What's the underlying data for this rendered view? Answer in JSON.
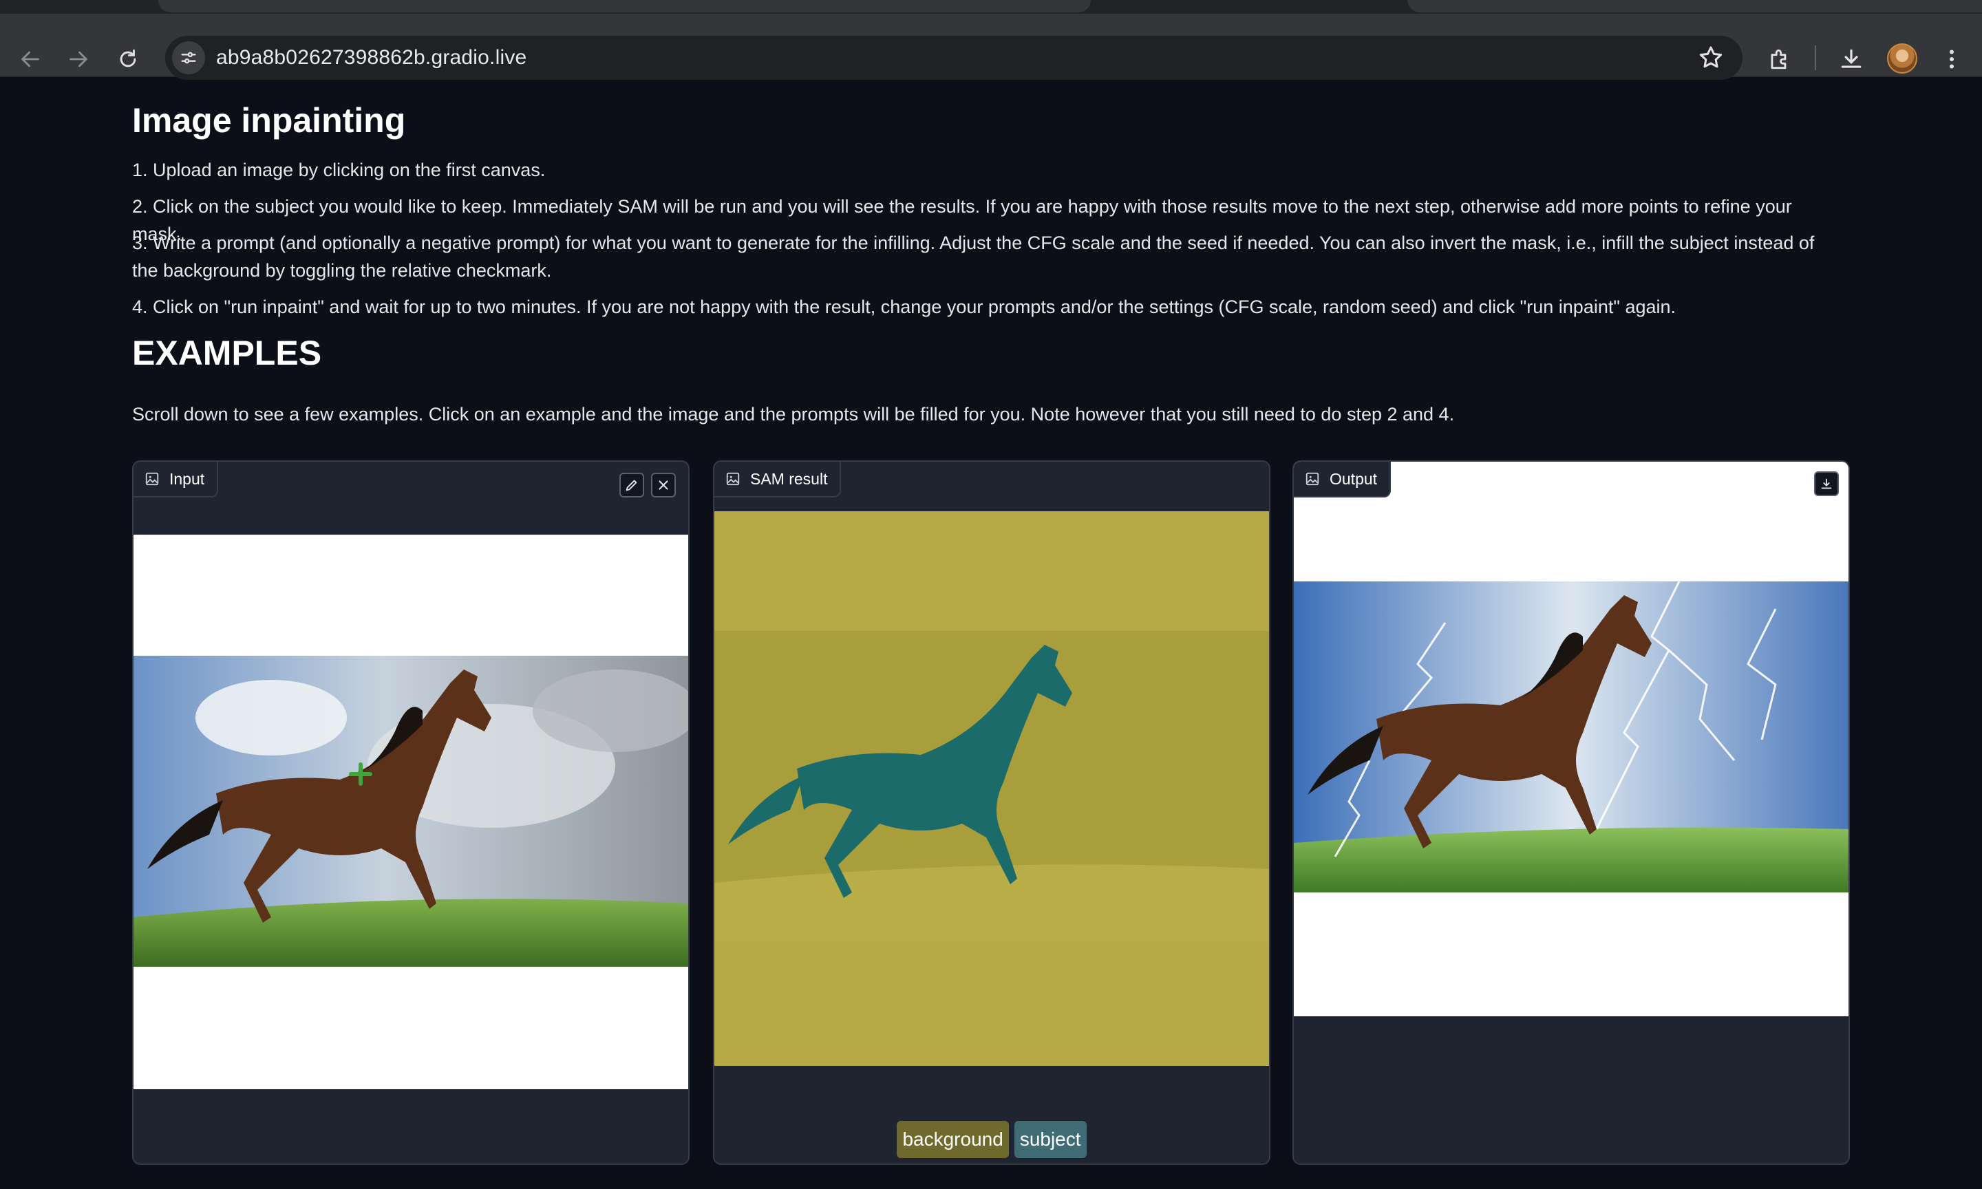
{
  "browser": {
    "url": "ab9a8b02627398862b.gradio.live"
  },
  "page": {
    "title": "Image inpainting",
    "steps": [
      "1. Upload an image by clicking on the first canvas.",
      "2. Click on the subject you would like to keep. Immediately SAM will be run and you will see the results. If you are happy with those results move to the next step, otherwise add more points to refine your mask.",
      "3. Write a prompt (and optionally a negative prompt) for what you want to generate for the infilling. Adjust the CFG scale and the seed if needed. You can also invert the mask, i.e., infill the subject instead of the background by toggling the relative checkmark.",
      "4. Click on \"run inpaint\" and wait for up to two minutes. If you are not happy with the result, change your prompts and/or the settings (CFG scale, random seed) and click \"run inpaint\" again."
    ],
    "examples_title": "EXAMPLES",
    "examples_text": "Scroll down to see a few examples. Click on an example and the image and the prompts will be filled for you. Note however that you still need to do step 2 and 4."
  },
  "panels": {
    "input": {
      "label": "Input",
      "label_icon": "image-icon",
      "edit_icon": "pencil-icon",
      "clear_icon": "close-icon"
    },
    "sam": {
      "label": "SAM result",
      "label_icon": "image-icon"
    },
    "output": {
      "label": "Output",
      "label_icon": "image-icon",
      "download_icon": "download-icon"
    }
  },
  "legend": [
    {
      "label": "background",
      "color": "#6f6a2c"
    },
    {
      "label": "subject",
      "color": "#3f6b74"
    }
  ],
  "colors": {
    "page_bg": "#0c0f17",
    "panel_bg": "#1f2430",
    "mask_background": "#b5aa45",
    "mask_subject": "#1c6b6b",
    "point_marker": "#3fa63a"
  }
}
